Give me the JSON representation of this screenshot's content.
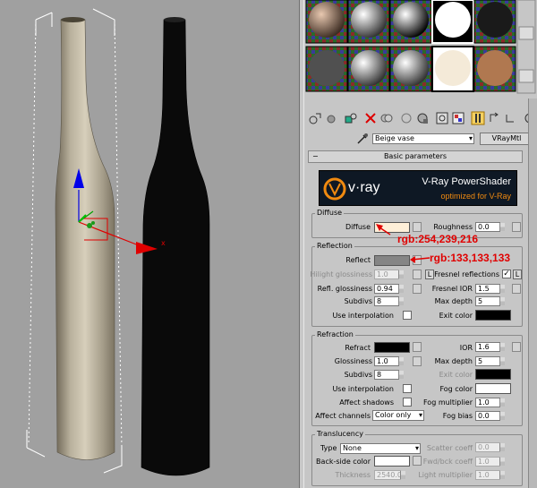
{
  "material_editor": {
    "material_name": "Beige vase",
    "material_type": "VRayMtl",
    "rollout_title": "Basic parameters",
    "banner": {
      "logo": "v·ray",
      "title": "V-Ray PowerShader",
      "subtitle": "optimized for V-Ray"
    },
    "diffuse": {
      "group": "Diffuse",
      "diffuse_label": "Diffuse",
      "diffuse_color": "#FEEFD8",
      "roughness_label": "Roughness",
      "roughness": "0.0"
    },
    "reflection": {
      "group": "Reflection",
      "reflect_label": "Reflect",
      "reflect_color": "#858585",
      "hilight_label": "Hilight glossiness",
      "hilight_value": "1.0",
      "l_button": "L",
      "fresnel_label": "Fresnel reflections",
      "fresnel_checked": "✓",
      "refl_gloss_label": "Refl. glossiness",
      "refl_gloss": "0.94",
      "fresnel_ior_label": "Fresnel IOR",
      "fresnel_ior": "1.5",
      "subdivs_label": "Subdivs",
      "subdivs": "8",
      "max_depth_label": "Max depth",
      "max_depth": "5",
      "use_interp_label": "Use interpolation",
      "exit_color_label": "Exit color"
    },
    "refraction": {
      "group": "Refraction",
      "refract_label": "Refract",
      "ior_label": "IOR",
      "ior": "1.6",
      "gloss_label": "Glossiness",
      "gloss": "1.0",
      "max_depth_label": "Max depth",
      "max_depth": "5",
      "subdivs_label": "Subdivs",
      "subdivs": "8",
      "exit_color_label": "Exit color",
      "use_interp_label": "Use interpolation",
      "fog_color_label": "Fog color",
      "affect_shadows_label": "Affect shadows",
      "fog_mult_label": "Fog multiplier",
      "fog_mult": "1.0",
      "affect_channels_label": "Affect channels",
      "affect_channels": "Color only",
      "fog_bias_label": "Fog bias",
      "fog_bias": "0.0"
    },
    "translucency": {
      "group": "Translucency",
      "type_label": "Type",
      "type_value": "None",
      "scatter_label": "Scatter coeff",
      "scatter": "0.0",
      "backside_label": "Back-side color",
      "fwdbck_label": "Fwd/bck coeff",
      "fwdbck": "1.0",
      "thickness_label": "Thickness",
      "thickness": "2540.0",
      "light_mult_label": "Light multiplier",
      "light_mult": "1.0"
    }
  },
  "annotations": {
    "diffuse_rgb": "rgb:254,239,216",
    "reflect_rgb": "rgb:133,133,133"
  },
  "viewport": {
    "axis_x": "x"
  },
  "colors": {
    "accent_red": "#e00000",
    "panel_bg": "#c6c6c6",
    "viewport_bg": "#a0a0a0"
  }
}
